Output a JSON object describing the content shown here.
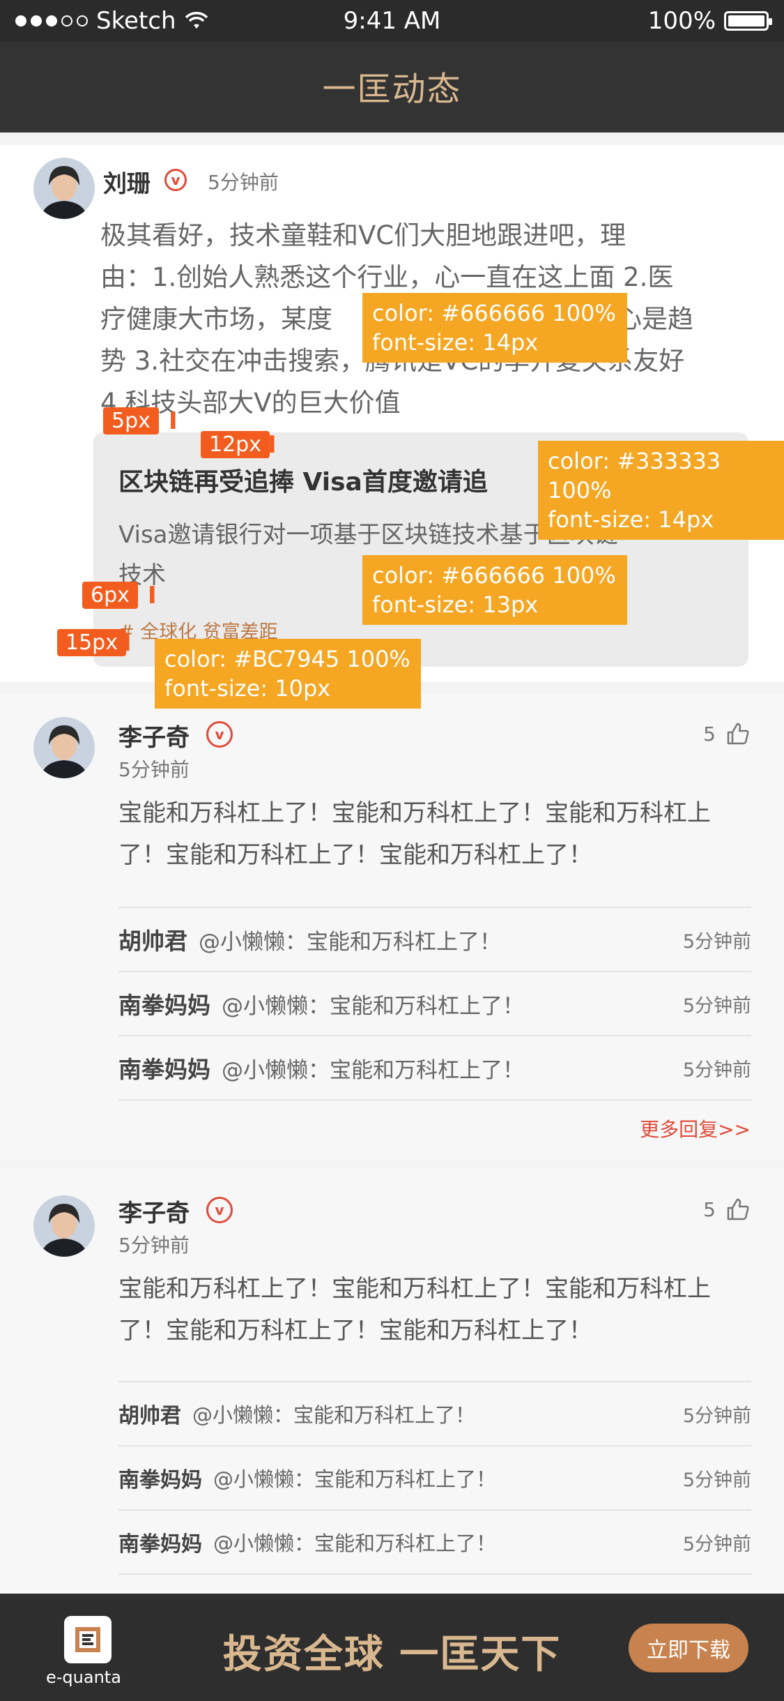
{
  "status_bar": {
    "carrier": "Sketch",
    "time": "9:41 AM",
    "battery": "100%"
  },
  "header": {
    "title": "一匡动态"
  },
  "post": {
    "author": "刘珊",
    "time": "5分钟前",
    "content_lines": [
      "极其看好，技术童鞋和VC们大胆地跟进吧，理",
      "由：1.创始人熟悉这个行业，心一直在这上面 2.医",
      "疗健康大市场，某度",
      "民心是趋",
      "势 3.社交在冲击搜索，腾讯是VC的李开复关系友好",
      "4.科技头部大V的巨大价值"
    ],
    "quote": {
      "title": "区块链再受追捧 Visa首度邀请追",
      "desc_lines": [
        "Visa邀请银行对一项基于区块链技术基于区块链",
        "技术"
      ],
      "tags": "# 全球化 贫富差距"
    }
  },
  "comments": [
    {
      "author": "李子奇",
      "time": "5分钟前",
      "likes": "5",
      "content_lines": [
        "宝能和万科杠上了！宝能和万科杠上了！宝能和万科杠上",
        "了！宝能和万科杠上了！宝能和万科杠上了！"
      ],
      "replies": [
        {
          "name": "胡帅君",
          "text": "@小懒懒：宝能和万科杠上了！",
          "time": "5分钟前"
        },
        {
          "name": "南拳妈妈",
          "text": "@小懒懒：宝能和万科杠上了！",
          "time": "5分钟前"
        },
        {
          "name": "南拳妈妈",
          "text": "@小懒懒：宝能和万科杠上了！",
          "time": "5分钟前"
        }
      ],
      "more": "更多回复>>"
    },
    {
      "author": "李子奇",
      "time": "5分钟前",
      "likes": "5",
      "content_lines": [
        "宝能和万科杠上了！宝能和万科杠上了！宝能和万科杠上",
        "了！宝能和万科杠上了！宝能和万科杠上了！"
      ],
      "replies": [
        {
          "name": "胡帅君",
          "text": "@小懒懒：宝能和万科杠上了！",
          "time": "5分钟前"
        },
        {
          "name": "南拳妈妈",
          "text": "@小懒懒：宝能和万科杠上了！",
          "time": "5分钟前"
        },
        {
          "name": "南拳妈妈",
          "text": "@小懒懒：宝能和万科杠上了！",
          "time": "5分钟前"
        }
      ]
    }
  ],
  "annotations": {
    "a1_color": "color: #666666 100%",
    "a1_size": "font-size: 14px",
    "a2_color": "color: #333333 100%",
    "a2_size": "font-size: 14px",
    "a3_color": "color: #666666 100%",
    "a3_size": "font-size: 13px",
    "a4_color": "color: #BC7945 100%",
    "a4_size": "font-size: 10px",
    "spacing_5": "5px",
    "spacing_12": "12px",
    "spacing_6": "6px",
    "spacing_15": "15px"
  },
  "banner": {
    "logo_text": "e-quanta",
    "slogan": "投资全球 一匡天下",
    "download": "立即下载"
  },
  "colors": {
    "header_bg": "#333333",
    "title": "#d9b88f",
    "tag": "#BC7945",
    "annotation": "#f5a623",
    "accent": "#e04a3a"
  }
}
